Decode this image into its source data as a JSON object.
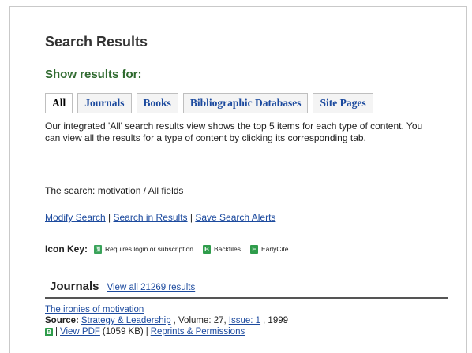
{
  "page": {
    "title": "Search Results",
    "show_results_for": "Show results for:"
  },
  "tabs": [
    {
      "label": "All",
      "active": true
    },
    {
      "label": "Journals",
      "active": false
    },
    {
      "label": "Books",
      "active": false
    },
    {
      "label": "Bibliographic Databases",
      "active": false
    },
    {
      "label": "Site Pages",
      "active": false
    }
  ],
  "description": "Our integrated 'All' search results view shows the top 5 items for each type of content. You can view all the results for a type of content by clicking its corresponding tab.",
  "search": {
    "prefix": "The search: ",
    "query": "motivation / All fields"
  },
  "actions": {
    "modify": "Modify Search",
    "in_results": "Search in Results",
    "save_alerts": "Save Search Alerts",
    "separator": " | "
  },
  "icon_key": {
    "title": "Icon Key:",
    "items": [
      {
        "icon": "lock-icon",
        "badge": "⚿",
        "label": "Requires login or subscription"
      },
      {
        "icon": "backfiles-icon",
        "badge": "B",
        "label": "Backfiles"
      },
      {
        "icon": "earlycite-icon",
        "badge": "E",
        "label": "EarlyCite"
      }
    ]
  },
  "journals": {
    "title": "Journals",
    "view_all": "View all 21269 results",
    "results": [
      {
        "title": "The ironies of motivation",
        "source_label": "Source:",
        "source": "Strategy & Leadership",
        "volume": ", Volume: 27, ",
        "issue": "Issue: 1",
        "year": ", 1999",
        "badge": "B",
        "view_pdf": "View PDF",
        "pdf_size": " (1059 KB) ",
        "reprints": "Reprints & Permissions"
      }
    ]
  },
  "colors": {
    "link": "#1c4a9e",
    "heading_green": "#2f6a2f",
    "badge_green": "#2f9c4b"
  }
}
